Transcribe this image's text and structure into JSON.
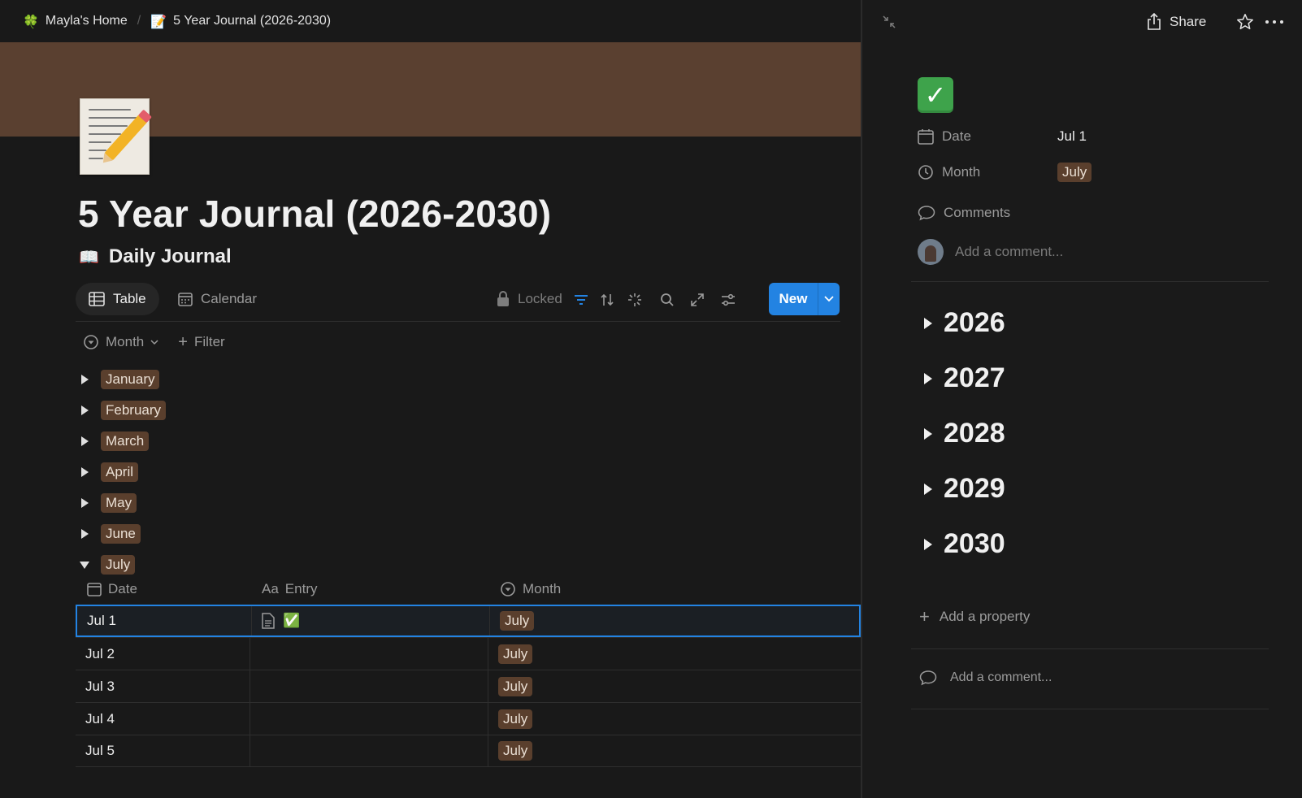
{
  "breadcrumb": {
    "home_icon": "🍀",
    "home_label": "Mayla's Home",
    "separator": "/",
    "page_icon": "📝",
    "page_label": "5 Year Journal (2026-2030)"
  },
  "page": {
    "title": "5 Year Journal (2026-2030)",
    "subtitle_icon": "📖",
    "subtitle": "Daily Journal",
    "icon_name": "memo-icon"
  },
  "views": {
    "tabs": [
      {
        "label": "Table",
        "icon": "table-icon",
        "active": true
      },
      {
        "label": "Calendar",
        "icon": "calendar-icon",
        "active": false
      }
    ],
    "locked_label": "Locked",
    "new_label": "New"
  },
  "grouping": {
    "group_label": "Month",
    "filter_label": "Filter"
  },
  "groups": [
    "January",
    "February",
    "March",
    "April",
    "May",
    "June",
    "July"
  ],
  "expanded_group": "July",
  "table": {
    "columns": [
      {
        "label": "Date",
        "icon": "calendar-icon"
      },
      {
        "label": "Entry",
        "icon": "text-aa-icon"
      },
      {
        "label": "Month",
        "icon": "select-icon"
      }
    ],
    "rows": [
      {
        "date": "Jul 1",
        "entry": "✅",
        "month": "July",
        "selected": true
      },
      {
        "date": "Jul 2",
        "entry": "",
        "month": "July",
        "selected": false
      },
      {
        "date": "Jul 3",
        "entry": "",
        "month": "July",
        "selected": false
      },
      {
        "date": "Jul 4",
        "entry": "",
        "month": "July",
        "selected": false
      },
      {
        "date": "Jul 5",
        "entry": "",
        "month": "July",
        "selected": false
      }
    ]
  },
  "side_peek": {
    "share_label": "Share",
    "page_icon": "✅",
    "properties": [
      {
        "name": "Date",
        "icon": "calendar-icon",
        "value": "Jul 1"
      },
      {
        "name": "Month",
        "icon": "select-icon",
        "value": "July"
      }
    ],
    "comments_label": "Comments",
    "comment_placeholder": "Add a comment...",
    "years": [
      "2026",
      "2027",
      "2028",
      "2029",
      "2030"
    ],
    "add_property_label": "Add a property",
    "bottom_comment_placeholder": "Add a comment..."
  },
  "colors": {
    "accent": "#2383e2",
    "tag_brown": "#5a3f2d",
    "cover": "#5a4030",
    "background": "#191919"
  }
}
